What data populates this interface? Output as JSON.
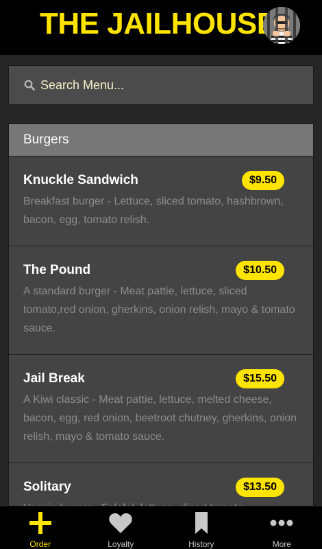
{
  "header": {
    "title": "THE JAILHOUSE"
  },
  "search": {
    "placeholder": "Search Menu..."
  },
  "menu": {
    "section_title": "Burgers",
    "items": [
      {
        "name": "Knuckle Sandwich",
        "price": "$9.50",
        "description": "Breakfast burger - Lettuce, sliced tomato, hashbrown, bacon, egg, tomato relish."
      },
      {
        "name": "The Pound",
        "price": "$10.50",
        "description": "A standard burger - Meat pattie, lettuce, sliced tomato,red onion, gherkins, onion relish, mayo & tomato sauce."
      },
      {
        "name": "Jail Break",
        "price": "$15.50",
        "description": "A Kiwi classic - Meat pattie, lettuce, melted cheese, bacon, egg, red onion, beetroot chutney, gherkins, onion relish, mayo & tomato sauce."
      },
      {
        "name": "Solitary",
        "price": "$13.50",
        "description": "Veggie burger - Falafel, lettuce, sliced tomato,"
      }
    ]
  },
  "tabs": [
    {
      "label": "Order",
      "icon": "plus-icon",
      "active": true
    },
    {
      "label": "Loyalty",
      "icon": "heart-icon",
      "active": false
    },
    {
      "label": "History",
      "icon": "bookmark-icon",
      "active": false
    },
    {
      "label": "More",
      "icon": "more-dots-icon",
      "active": false
    }
  ],
  "colors": {
    "accent": "#ffe400",
    "background": "#262626",
    "card": "#444444",
    "section_header": "#777777"
  }
}
